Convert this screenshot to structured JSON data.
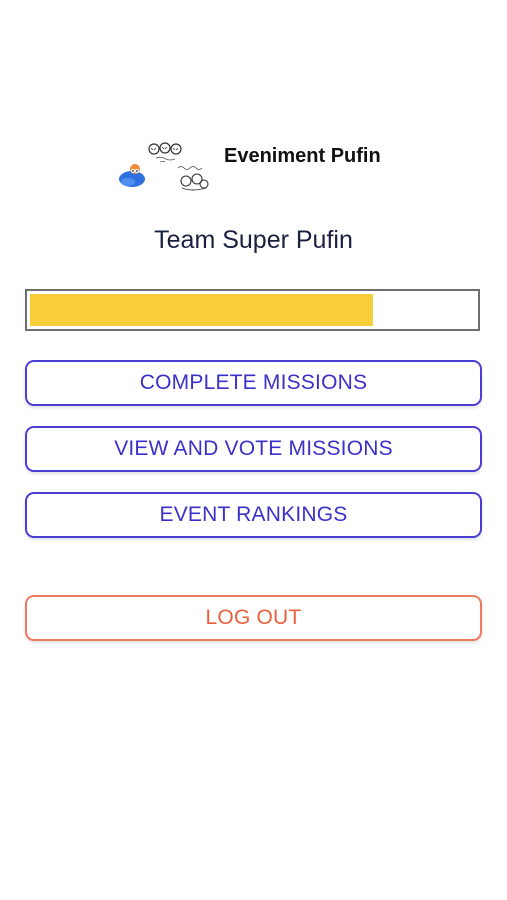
{
  "header": {
    "logo_icon": "puffin-doodle-logo",
    "event_name": "Eveniment Pufin"
  },
  "team": {
    "name": "Team Super Pufin"
  },
  "progress": {
    "fraction": 0.77,
    "fill_color": "#f9ce3d"
  },
  "actions": {
    "complete_missions": "COMPLETE MISSIONS",
    "view_and_vote": "VIEW AND VOTE MISSIONS",
    "event_rankings": "EVENT RANKINGS",
    "log_out": "LOG OUT"
  },
  "colors": {
    "accent": "#3b30c9",
    "danger": "#e9613f"
  }
}
